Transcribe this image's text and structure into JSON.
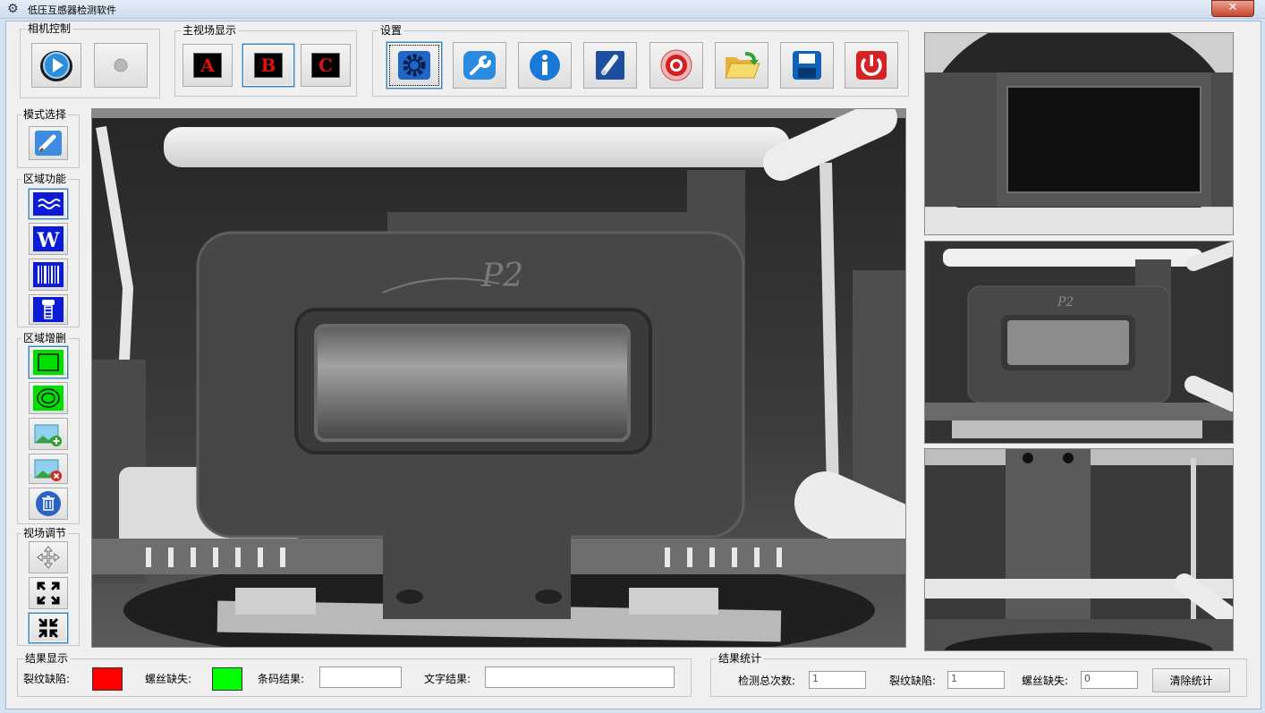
{
  "window": {
    "title": "低压互感器检测软件",
    "close_glyph": "✕"
  },
  "groups": {
    "camera": "相机控制",
    "main_view": "主视场显示",
    "settings": "设置",
    "mode": "模式选择",
    "region_func": "区域功能",
    "region_edit": "区域增删",
    "view_adjust": "视场调节",
    "result_show": "结果显示",
    "result_stats": "结果统计"
  },
  "main_view_buttons": [
    "A",
    "B",
    "C"
  ],
  "settings_icons": [
    "gear-icon",
    "wrench-icon",
    "info-icon",
    "brush-icon",
    "target-icon",
    "folder-open-icon",
    "save-icon",
    "power-icon"
  ],
  "results": {
    "crack_label": "裂纹缺陷:",
    "screw_label": "螺丝缺失:",
    "barcode_label": "条码结果:",
    "text_label": "文字结果:",
    "barcode_value": "",
    "text_value": "",
    "crack_color": "#ff0000",
    "screw_color": "#00ff00"
  },
  "stats": {
    "total_label": "检测总次数:",
    "total_value": "1",
    "crack_label": "裂纹缺陷:",
    "crack_value": "1",
    "screw_label": "螺丝缺失:",
    "screw_value": "0",
    "clear_button": "清除统计"
  },
  "camera_views": {
    "main": {
      "marking": "P2"
    },
    "view2": {
      "marking": "P2"
    }
  }
}
